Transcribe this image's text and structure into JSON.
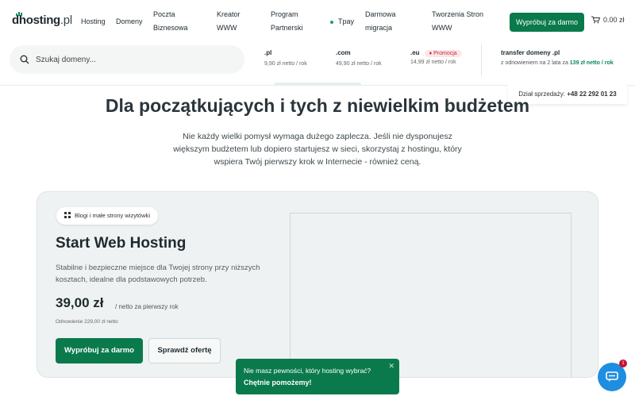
{
  "header": {
    "logo_main": "dhosting",
    "logo_tld": ".pl",
    "nav": [
      {
        "line1": "Hosting",
        "line2": ""
      },
      {
        "line1": "Domeny",
        "line2": ""
      },
      {
        "line1": "Poczta",
        "line2": "Biznesowa"
      },
      {
        "line1": "Kreator",
        "line2": "WWW"
      },
      {
        "line1": "Program",
        "line2": "Partnerski"
      },
      {
        "line1": "Tpay",
        "line2": ""
      },
      {
        "line1": "Darmowa",
        "line2": "migracja"
      },
      {
        "line1": "Tworzenia Stron",
        "line2": "WWW"
      }
    ],
    "cta_label": "Wypróbuj za darmo",
    "cart_value": "0.00 zł",
    "accent": "#0a7a4c"
  },
  "search": {
    "placeholder": "Szukaj domeny...",
    "domains": [
      {
        "tld": ".pl",
        "price": "9,90 zł netto / rok",
        "promo": ""
      },
      {
        "tld": ".com",
        "price": "49,90 zł netto / rok",
        "promo": ""
      },
      {
        "tld": ".eu",
        "price": "14,99 zł netto / rok",
        "promo": "Promocja"
      }
    ],
    "transfer_title": "transfer domeny .pl",
    "transfer_sub_prefix": "z odnowieniem na 2 lata za ",
    "transfer_sub_price": "139 zł netto / rok"
  },
  "sales": {
    "label": "Dział sprzedaży:",
    "phone": "+48 22 292 01 23"
  },
  "hero": {
    "title": "Dla początkujących i tych z niewielkim budżetem",
    "subtitle": "Nie każdy wielki pomysł wymaga dużego zaplecza. Jeśli nie dysponujesz większym budżetem lub dopiero startujesz w sieci, skorzystaj z hostingu, który wspiera Twój pierwszy krok w Internecie - również ceną."
  },
  "card": {
    "chip": "Blogi i małe strony wizytówki",
    "title": "Start Web Hosting",
    "description": "Stabilne i bezpieczne miejsce dla Twojej strony przy niższych kosztach, idealne dla podstawowych potrzeb.",
    "price": "39,00 zł",
    "price_note": "/ netto za pierwszy rok",
    "renewal": "Odnowienie 229,00 zł netto",
    "primary_label": "Wypróbuj za darmo",
    "secondary_label": "Sprawdź ofertę"
  },
  "chat": {
    "line1": "Nie masz pewności, który hosting wybrać?",
    "line2": "Chętnie pomożemy!",
    "badge": "1"
  }
}
